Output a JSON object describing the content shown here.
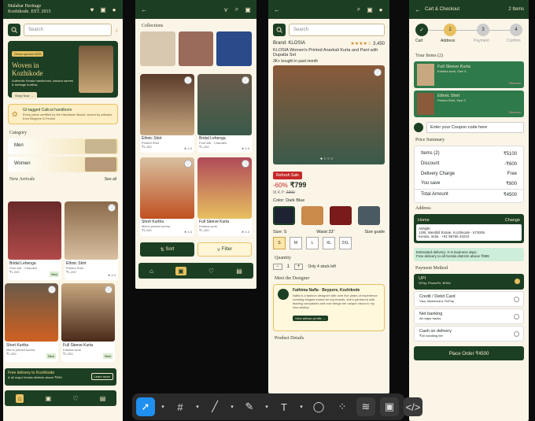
{
  "home": {
    "brand": "Malabar Heritage\nKozhikode. EST. 2015",
    "search_placeholder": "Search",
    "banner_badge": "Onam special 2026",
    "banner_title": "Woven in\nKozhikode",
    "banner_sub": "Authentic Kerala handlooms, kasavu sarees & heritage kurthas",
    "banner_cta": "Shop Now →",
    "gi_title": "GI-tagged Calicut handloom",
    "gi_sub": "Every piece certified by the Handloom Board, woven by artisans from Beypore & Feroke",
    "category_title": "Category",
    "cat_men": "Men",
    "cat_women": "Women",
    "new_arrivals": "New Arrivals",
    "see_all": "See all",
    "products": [
      {
        "name": "Bridal Lehenga",
        "meta": "Pure silk · Chanderi",
        "price": "₹1,200",
        "rating": "★ 4.5",
        "tag": "New"
      },
      {
        "name": "Ethnic Shirt",
        "meta": "Printed Shirt",
        "price": "₹1,200",
        "rating": "★ 4.3",
        "tag": ""
      },
      {
        "name": "Short Kurtha",
        "meta": "Men's printed kurtha",
        "price": "₹1,200",
        "rating": "",
        "tag": "New"
      },
      {
        "name": "Full Sleeve Kurta",
        "meta": "Kristina work",
        "price": "₹1,200",
        "rating": "★ 4.3",
        "tag": "New"
      }
    ],
    "delivery_title": "Free delivery to Kozhikode",
    "delivery_sub": "& all major Kerala districts above ₹999",
    "learn_more": "Learn more"
  },
  "listing": {
    "collections": "Collections",
    "items": [
      {
        "name": "Ethnic Shirt",
        "meta": "Printed Shirt",
        "price": "₹1,200",
        "rating": "★ 4.3"
      },
      {
        "name": "Bridal Lehenga",
        "meta": "Pure silk · Chanderi",
        "price": "₹1,200",
        "rating": "★ 4.5"
      },
      {
        "name": "Short Kurtha",
        "meta": "Men's printed kurtha",
        "price": "₹1,200",
        "rating": "★ 4.3"
      },
      {
        "name": "Full Sleeve Kurta",
        "meta": "Kristina work",
        "price": "₹1,200",
        "rating": "★ 4.3"
      }
    ],
    "sort": "Sort",
    "filter": "Filter"
  },
  "detail": {
    "search_placeholder": "Search",
    "brand": "Brand: KLOSIA",
    "rating": "3,450",
    "title": "KLOSIA Women's Printed Anarkali Kurta and Pant with Dupatta Set",
    "bought": "3K+ bought in past month",
    "sale": "Refresh Sale",
    "discount": "-60%",
    "price": "₹799",
    "mrp_label": "M.R.P:",
    "mrp": "2300",
    "color_label": "Color: Dark Blue",
    "size_label": "Size: S",
    "waist": "Waist 33\"",
    "size_guide": "Size guide",
    "sizes": [
      "S",
      "M",
      "L",
      "XL",
      "2XL"
    ],
    "quantity_label": "Quantity",
    "qty": "1",
    "stock": "Only 4 stock left",
    "designer_section": "Meet the Designer",
    "designer_name": "Fathima Nafla · Beypore, Kozhikode",
    "designer_bio": "Nafla is a fashion designer with over five years of experience creating elegant kurtas for top brands, she's partnered with leading companies and now brings her unique vision to my new startup.",
    "view_profile": "View artisan profile →",
    "product_details": "Product Details"
  },
  "cart": {
    "title": "Cart & Checkout",
    "items_count": "2 Items",
    "steps": [
      "Cart",
      "Address",
      "Payment",
      "Confirm"
    ],
    "your_items": "Your Items (2)",
    "items": [
      {
        "name": "Full Sleeve Kurta",
        "meta": "Kristina work, Size S",
        "price": "₹1,200",
        "qty": "1",
        "remove": "Remove"
      },
      {
        "name": "Ethnic Shirt",
        "meta": "Printed Shirt, Size S",
        "price": "₹1,200",
        "qty": "1",
        "remove": "Remove"
      }
    ],
    "coupon": "Enter your Coupon code here",
    "price_summary": "Price Summary",
    "summary": [
      [
        "Items (2)",
        "₹5100"
      ],
      [
        "Discount",
        "-₹600"
      ],
      [
        "Delivery Charge",
        "Free"
      ],
      [
        "You save",
        "₹800"
      ]
    ],
    "total_label": "Total Amount",
    "total": "₹4500",
    "address_label": "Address",
    "addr_type": "Home",
    "change": "Change",
    "addr_name": "Abhijith",
    "addr_line": "12/B, Westhill Estate, Kozhikode - 673005",
    "addr_phone": "Kerala, India · +91 98765 43210",
    "est_delivery": "Estimated delivery: 3–5 business days.",
    "est_sub": "Free delivery to all Kerala districts above ₹999",
    "payment_label": "Payment Method",
    "payments": [
      {
        "name": "UPI",
        "sub": "GPay, PhonePe, BHIM",
        "selected": true
      },
      {
        "name": "Credit / Debit Card",
        "sub": "Visa, Mastercard, RuPay",
        "selected": false
      },
      {
        "name": "Net banking",
        "sub": "All major banks",
        "selected": false
      },
      {
        "name": "Cash on delivery",
        "sub": "₹40 handling fee",
        "selected": false
      }
    ],
    "place_order": "Place Order ₹4500"
  },
  "colors": {
    "primary": "#1c3f24",
    "accent": "#e8c060",
    "sale": "#c62828",
    "cream": "#fbf5e8"
  }
}
